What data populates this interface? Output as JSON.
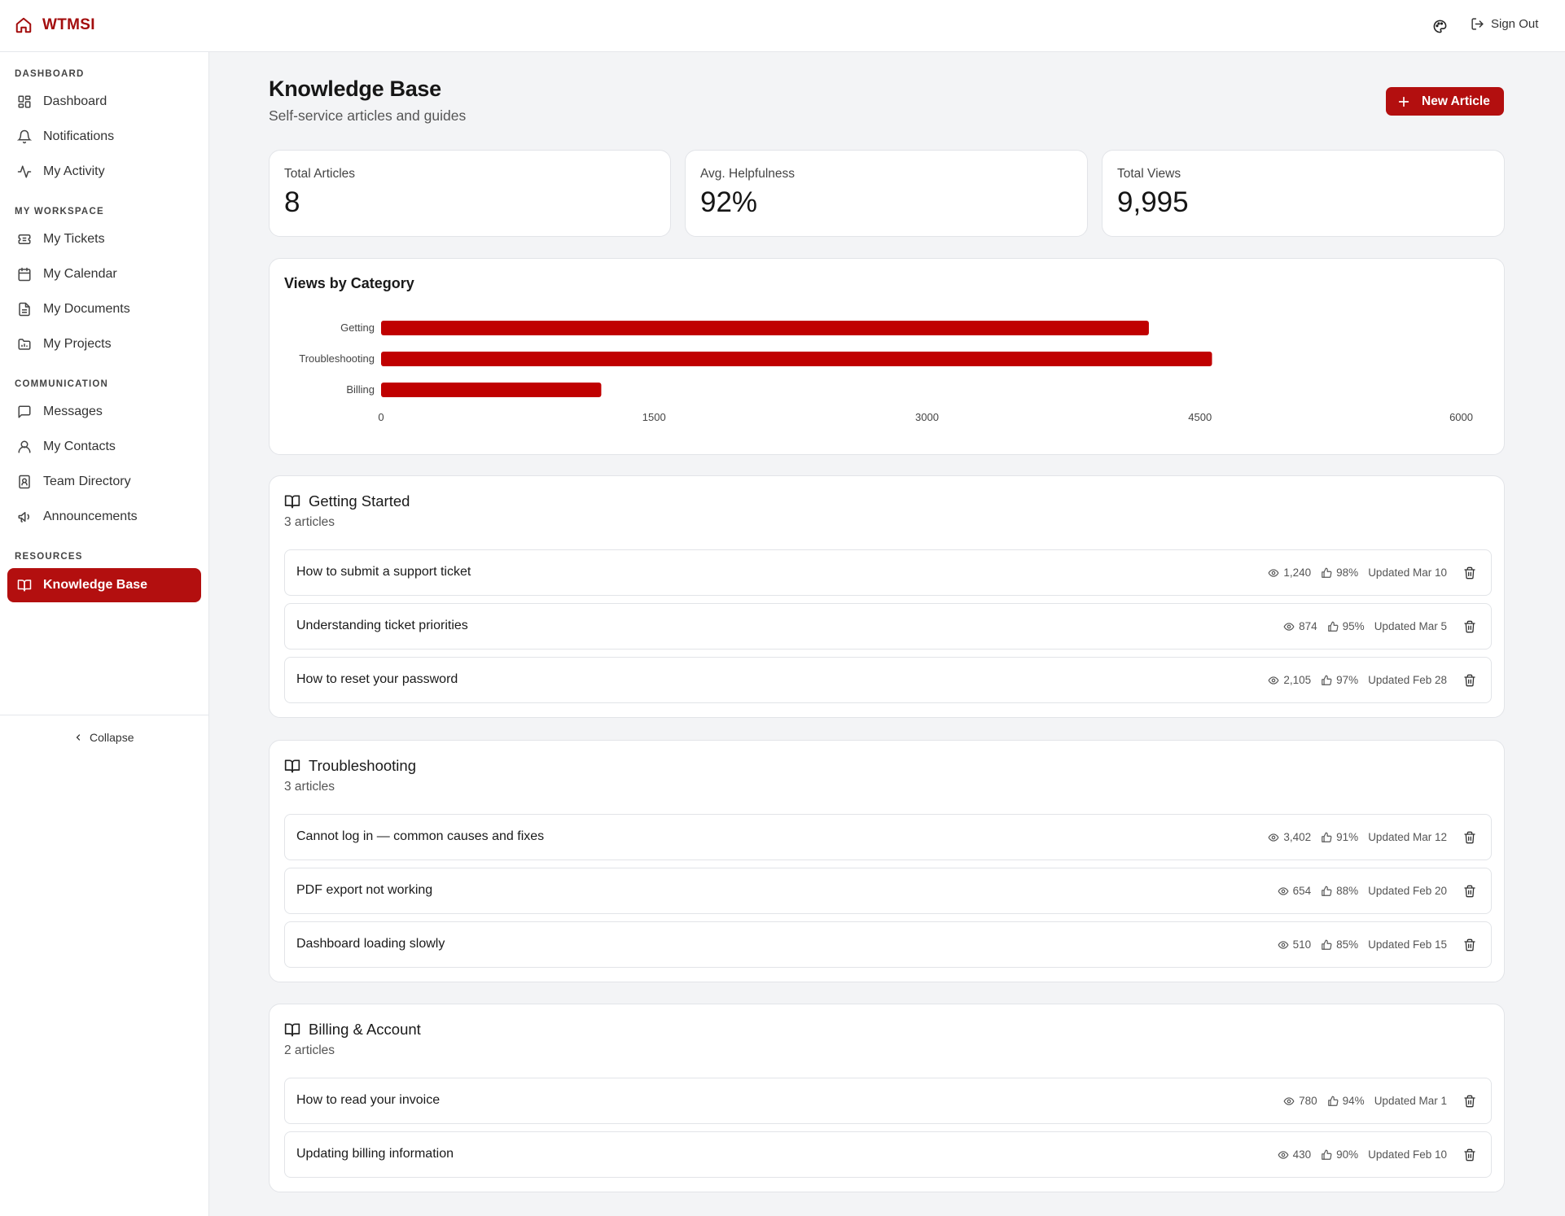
{
  "app": {
    "brand": "WTMSI",
    "sign_out": "Sign Out"
  },
  "sidebar": {
    "sections": [
      {
        "label": "DASHBOARD",
        "items": [
          {
            "label": "Dashboard",
            "icon": "dashboard-icon"
          },
          {
            "label": "Notifications",
            "icon": "bell-icon"
          },
          {
            "label": "My Activity",
            "icon": "activity-icon"
          }
        ]
      },
      {
        "label": "MY WORKSPACE",
        "items": [
          {
            "label": "My Tickets",
            "icon": "ticket-icon"
          },
          {
            "label": "My Calendar",
            "icon": "calendar-icon"
          },
          {
            "label": "My Documents",
            "icon": "document-icon"
          },
          {
            "label": "My Projects",
            "icon": "folder-icon"
          }
        ]
      },
      {
        "label": "COMMUNICATION",
        "items": [
          {
            "label": "Messages",
            "icon": "message-icon"
          },
          {
            "label": "My Contacts",
            "icon": "user-icon"
          },
          {
            "label": "Team Directory",
            "icon": "directory-icon"
          },
          {
            "label": "Announcements",
            "icon": "megaphone-icon"
          }
        ]
      },
      {
        "label": "RESOURCES",
        "items": [
          {
            "label": "Knowledge Base",
            "icon": "book-icon",
            "active": true
          }
        ]
      }
    ],
    "collapse": "Collapse"
  },
  "page": {
    "title": "Knowledge Base",
    "subtitle": "Self-service articles and guides",
    "new_article": "New Article"
  },
  "stats": [
    {
      "label": "Total Articles",
      "value": "8"
    },
    {
      "label": "Avg. Helpfulness",
      "value": "92%"
    },
    {
      "label": "Total Views",
      "value": "9,995"
    }
  ],
  "chart": {
    "title": "Views by Category",
    "accent": "#c00000"
  },
  "chart_data": {
    "type": "bar",
    "orientation": "horizontal",
    "title": "Views by Category",
    "categories": [
      "Getting",
      "Troubleshooting",
      "Billing"
    ],
    "values": [
      4219,
      4566,
      1210
    ],
    "xlim": [
      0,
      6000
    ],
    "xticks": [
      "0",
      "1500",
      "3000",
      "4500",
      "6000"
    ],
    "xlabel": "",
    "ylabel": "",
    "grid": false,
    "legend": "none"
  },
  "groups": [
    {
      "title": "Getting Started",
      "count": "3 articles",
      "articles": [
        {
          "title": "How to submit a support ticket",
          "views": "1,240",
          "helpful": "98%",
          "updated": "Updated Mar 10"
        },
        {
          "title": "Understanding ticket priorities",
          "views": "874",
          "helpful": "95%",
          "updated": "Updated Mar 5"
        },
        {
          "title": "How to reset your password",
          "views": "2,105",
          "helpful": "97%",
          "updated": "Updated Feb 28"
        }
      ]
    },
    {
      "title": "Troubleshooting",
      "count": "3 articles",
      "articles": [
        {
          "title": "Cannot log in — common causes and fixes",
          "views": "3,402",
          "helpful": "91%",
          "updated": "Updated Mar 12"
        },
        {
          "title": "PDF export not working",
          "views": "654",
          "helpful": "88%",
          "updated": "Updated Feb 20"
        },
        {
          "title": "Dashboard loading slowly",
          "views": "510",
          "helpful": "85%",
          "updated": "Updated Feb 15"
        }
      ]
    },
    {
      "title": "Billing & Account",
      "count": "2 articles",
      "articles": [
        {
          "title": "How to read your invoice",
          "views": "780",
          "helpful": "94%",
          "updated": "Updated Mar 1"
        },
        {
          "title": "Updating billing information",
          "views": "430",
          "helpful": "90%",
          "updated": "Updated Feb 10"
        }
      ]
    }
  ]
}
